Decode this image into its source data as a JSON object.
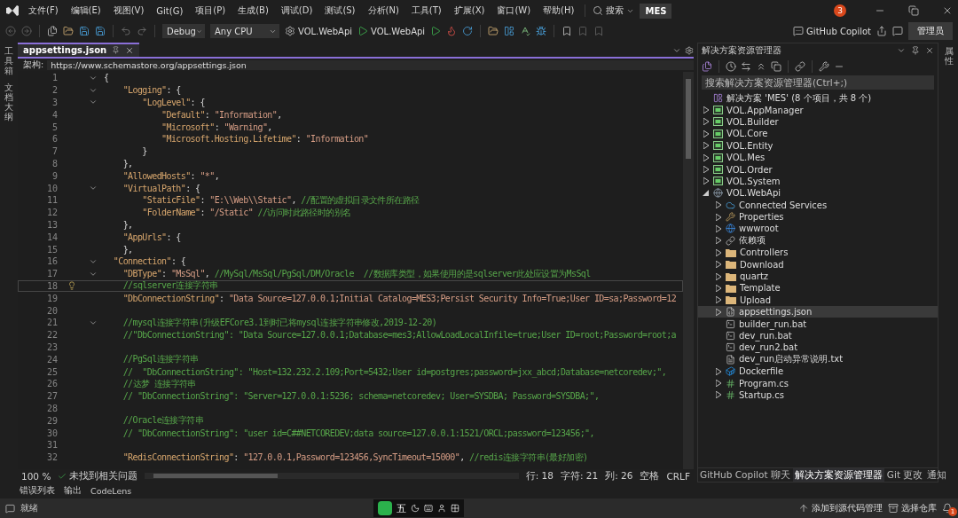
{
  "menu": {
    "items": [
      "文件(F)",
      "编辑(E)",
      "视图(V)",
      "Git(G)",
      "项目(P)",
      "生成(B)",
      "调试(D)",
      "测试(S)",
      "分析(N)",
      "工具(T)",
      "扩展(X)",
      "窗口(W)",
      "帮助(H)"
    ],
    "search": "搜索",
    "solution_badge": "MES",
    "notification_count": "3"
  },
  "toolbar": {
    "configuration": "Debug",
    "platform": "Any CPU",
    "startup_project": "VOL.WebApi",
    "run_target": "VOL.WebApi",
    "copilot": "GitHub Copilot",
    "account": "管理员"
  },
  "left_strip": [
    "工具箱",
    "文档大纲"
  ],
  "editor": {
    "tabs": [
      {
        "label": "appsettings.json",
        "selected": true
      }
    ],
    "schema_label": "架构:",
    "schema_url": "https://www.schemastore.org/appsettings.json",
    "lines": [
      {
        "number": "1",
        "fold": true,
        "current": false,
        "parts": [
          {
            "kind": "punct",
            "text": "{"
          }
        ]
      },
      {
        "number": "2",
        "fold": true,
        "current": false,
        "parts": [
          {
            "kind": "key",
            "text": "    \"Logging\""
          },
          {
            "kind": "punct",
            "text": ": {"
          }
        ]
      },
      {
        "number": "3",
        "fold": true,
        "current": false,
        "parts": [
          {
            "kind": "key",
            "text": "        \"LogLevel\""
          },
          {
            "kind": "punct",
            "text": ": {"
          }
        ]
      },
      {
        "number": "4",
        "fold": false,
        "current": false,
        "parts": [
          {
            "kind": "key",
            "text": "            \"Default\""
          },
          {
            "kind": "punct",
            "text": ": "
          },
          {
            "kind": "string",
            "text": "\"Information\""
          },
          {
            "kind": "punct",
            "text": ","
          }
        ]
      },
      {
        "number": "5",
        "fold": false,
        "current": false,
        "parts": [
          {
            "kind": "key",
            "text": "            \"Microsoft\""
          },
          {
            "kind": "punct",
            "text": ": "
          },
          {
            "kind": "string",
            "text": "\"Warning\""
          },
          {
            "kind": "punct",
            "text": ","
          }
        ]
      },
      {
        "number": "6",
        "fold": false,
        "current": false,
        "parts": [
          {
            "kind": "key",
            "text": "            \"Microsoft.Hosting.Lifetime\""
          },
          {
            "kind": "punct",
            "text": ": "
          },
          {
            "kind": "string",
            "text": "\"Information\""
          }
        ]
      },
      {
        "number": "7",
        "fold": false,
        "current": false,
        "parts": [
          {
            "kind": "punct",
            "text": "        }"
          }
        ]
      },
      {
        "number": "8",
        "fold": false,
        "current": false,
        "parts": [
          {
            "kind": "punct",
            "text": "    },"
          }
        ]
      },
      {
        "number": "9",
        "fold": false,
        "current": false,
        "parts": [
          {
            "kind": "key",
            "text": "    \"AllowedHosts\""
          },
          {
            "kind": "punct",
            "text": ": "
          },
          {
            "kind": "string",
            "text": "\"*\""
          },
          {
            "kind": "punct",
            "text": ","
          }
        ]
      },
      {
        "number": "10",
        "fold": true,
        "current": false,
        "parts": [
          {
            "kind": "key",
            "text": "    \"VirtualPath\""
          },
          {
            "kind": "punct",
            "text": ": {"
          }
        ]
      },
      {
        "number": "11",
        "fold": false,
        "current": false,
        "parts": [
          {
            "kind": "key",
            "text": "        \"StaticFile\""
          },
          {
            "kind": "punct",
            "text": ": "
          },
          {
            "kind": "string",
            "text": "\"E:\\\\Web\\\\Static\""
          },
          {
            "kind": "punct",
            "text": ", "
          },
          {
            "kind": "comment",
            "text": "//配置的虚拟目录文件所在路径"
          }
        ]
      },
      {
        "number": "12",
        "fold": false,
        "current": false,
        "parts": [
          {
            "kind": "key",
            "text": "        \"FolderName\""
          },
          {
            "kind": "punct",
            "text": ": "
          },
          {
            "kind": "string",
            "text": "\"/Static\""
          },
          {
            "kind": "comment",
            "text": " //访问时此路径时的别名"
          }
        ]
      },
      {
        "number": "13",
        "fold": false,
        "current": false,
        "parts": [
          {
            "kind": "punct",
            "text": "    },"
          }
        ]
      },
      {
        "number": "14",
        "fold": false,
        "current": false,
        "parts": [
          {
            "kind": "key",
            "text": "    \"AppUrls\""
          },
          {
            "kind": "punct",
            "text": ": {"
          }
        ]
      },
      {
        "number": "15",
        "fold": false,
        "current": false,
        "parts": [
          {
            "kind": "punct",
            "text": "    },"
          }
        ]
      },
      {
        "number": "16",
        "fold": true,
        "current": false,
        "parts": [
          {
            "kind": "key",
            "text": "  \"Connection\""
          },
          {
            "kind": "punct",
            "text": ": {"
          }
        ]
      },
      {
        "number": "17",
        "fold": true,
        "current": false,
        "parts": [
          {
            "kind": "key",
            "text": "    \"DBType\""
          },
          {
            "kind": "punct",
            "text": ": "
          },
          {
            "kind": "string",
            "text": "\"MsSql\""
          },
          {
            "kind": "punct",
            "text": ", "
          },
          {
            "kind": "comment",
            "text": "//MySql/MsSql/PgSql/DM/Oracle  //数据库类型，如果使用的是sqlserver此处应设置为MsSql"
          }
        ]
      },
      {
        "number": "18",
        "fold": false,
        "current": true,
        "parts": [
          {
            "kind": "comment",
            "text": "    //sqlserver连接字符串"
          }
        ]
      },
      {
        "number": "19",
        "fold": false,
        "current": false,
        "parts": [
          {
            "kind": "key",
            "text": "    \"DbConnectionString\""
          },
          {
            "kind": "punct",
            "text": ": "
          },
          {
            "kind": "string",
            "text": "\"Data Source=127.0.0.1;Initial Catalog=MES3;Persist Security Info=True;User ID=sa;Password=12"
          }
        ]
      },
      {
        "number": "20",
        "fold": false,
        "current": false
      },
      {
        "number": "21",
        "fold": true,
        "current": false,
        "parts": [
          {
            "kind": "comment",
            "text": "    //mysql连接字符串(升级EFCore3.1到时已将mysql连接字符串修改,2019-12-20)"
          }
        ]
      },
      {
        "number": "22",
        "fold": false,
        "current": false,
        "parts": [
          {
            "kind": "comment",
            "text": "    //\"DbConnectionString\": \"Data Source=127.0.0.1;Database=mes3;AllowLoadLocalInfile=true;User ID=root;Password=root;a"
          }
        ]
      },
      {
        "number": "23",
        "fold": false,
        "current": false
      },
      {
        "number": "24",
        "fold": false,
        "current": false,
        "parts": [
          {
            "kind": "comment",
            "text": "    //PgSql连接字符串"
          }
        ]
      },
      {
        "number": "25",
        "fold": false,
        "current": false,
        "parts": [
          {
            "kind": "comment",
            "text": "    //  \"DbConnectionString\": \"Host=132.232.2.109;Port=5432;User id=postgres;password=jxx_abcd;Database=netcoredev;\","
          }
        ]
      },
      {
        "number": "26",
        "fold": false,
        "current": false,
        "parts": [
          {
            "kind": "comment",
            "text": "    //达梦 连接字符串"
          }
        ]
      },
      {
        "number": "27",
        "fold": false,
        "current": false,
        "parts": [
          {
            "kind": "comment",
            "text": "    // \"DbConnectionString\": \"Server=127.0.0.1:5236; schema=netcoredev; User=SYSDBA; Password=SYSDBA;\","
          }
        ]
      },
      {
        "number": "28",
        "fold": false,
        "current": false
      },
      {
        "number": "29",
        "fold": false,
        "current": false,
        "parts": [
          {
            "kind": "comment",
            "text": "    //Oracle连接字符串"
          }
        ]
      },
      {
        "number": "30",
        "fold": false,
        "current": false,
        "parts": [
          {
            "kind": "comment",
            "text": "    // \"DbConnectionString\": \"user id=C##NETCOREDEV;data source=127.0.0.1:1521/ORCL;password=123456;\","
          }
        ]
      },
      {
        "number": "31",
        "fold": false,
        "current": false
      },
      {
        "number": "32",
        "fold": false,
        "current": false,
        "parts": [
          {
            "kind": "key",
            "text": "    \"RedisConnectionString\""
          },
          {
            "kind": "punct",
            "text": ": "
          },
          {
            "kind": "string",
            "text": "\"127.0.0.1,Password=123456,SyncTimeout=15000\""
          },
          {
            "kind": "punct",
            "text": ", "
          },
          {
            "kind": "comment",
            "text": "//redis连接字符串(最好加密)"
          }
        ]
      }
    ],
    "status": {
      "zoom": "100 %",
      "issues": "未找到相关问题",
      "line": "行: 18",
      "char": "字符: 21",
      "col": "列: 26",
      "spaces": "空格",
      "eol": "CRLF"
    }
  },
  "solution_explorer": {
    "title": "解决方案资源管理器",
    "search_placeholder": "搜索解决方案资源管理器(Ctrl+;)",
    "tree": [
      {
        "label": "解决方案 'MES' (8 个项目，共 8 个)",
        "kind": "solution",
        "selected": false,
        "children": [
          {
            "label": "VOL.AppManager",
            "kind": "project",
            "expandable": true,
            "expanded": false,
            "selected": false
          },
          {
            "label": "VOL.Builder",
            "kind": "project",
            "expandable": true,
            "expanded": false,
            "selected": false
          },
          {
            "label": "VOL.Core",
            "kind": "project",
            "expandable": true,
            "expanded": false,
            "selected": false
          },
          {
            "label": "VOL.Entity",
            "kind": "project",
            "expandable": true,
            "expanded": false,
            "selected": false
          },
          {
            "label": "VOL.Mes",
            "kind": "project",
            "expandable": true,
            "expanded": false,
            "selected": false
          },
          {
            "label": "VOL.Order",
            "kind": "project",
            "expandable": true,
            "expanded": false,
            "selected": false
          },
          {
            "label": "VOL.System",
            "kind": "project",
            "expandable": true,
            "expanded": false,
            "selected": false
          },
          {
            "label": "VOL.WebApi",
            "kind": "webproject",
            "expandable": true,
            "expanded": true,
            "selected": false,
            "children": [
              {
                "label": "Connected Services",
                "kind": "cloud",
                "expandable": true,
                "expanded": false,
                "selected": false
              },
              {
                "label": "Properties",
                "kind": "properties",
                "expandable": true,
                "expanded": false,
                "selected": false
              },
              {
                "label": "wwwroot",
                "kind": "globe",
                "expandable": true,
                "expanded": false,
                "selected": false
              },
              {
                "label": "依赖项",
                "kind": "dependencies",
                "expandable": true,
                "expanded": false,
                "selected": false
              },
              {
                "label": "Controllers",
                "kind": "folder",
                "expandable": true,
                "expanded": false,
                "selected": false
              },
              {
                "label": "Download",
                "kind": "folder",
                "expandable": true,
                "expanded": false,
                "selected": false
              },
              {
                "label": "quartz",
                "kind": "folder",
                "expandable": true,
                "expanded": false,
                "selected": false
              },
              {
                "label": "Template",
                "kind": "folder",
                "expandable": true,
                "expanded": false,
                "selected": false
              },
              {
                "label": "Upload",
                "kind": "folder",
                "expandable": true,
                "expanded": false,
                "selected": false
              },
              {
                "label": "appsettings.json",
                "kind": "json",
                "expandable": true,
                "expanded": false,
                "selected": true
              },
              {
                "label": "builder_run.bat",
                "kind": "bat",
                "expandable": false,
                "expanded": false,
                "selected": false
              },
              {
                "label": "dev_run.bat",
                "kind": "bat",
                "expandable": false,
                "expanded": false,
                "selected": false
              },
              {
                "label": "dev_run2.bat",
                "kind": "bat",
                "expandable": false,
                "expanded": false,
                "selected": false
              },
              {
                "label": "dev_run启动异常说明.txt",
                "kind": "text",
                "expandable": false,
                "expanded": false,
                "selected": false
              },
              {
                "label": "Dockerfile",
                "kind": "docker",
                "expandable": true,
                "expanded": false,
                "selected": false
              },
              {
                "label": "Program.cs",
                "kind": "csharp",
                "expandable": true,
                "expanded": false,
                "selected": false
              },
              {
                "label": "Startup.cs",
                "kind": "csharp",
                "expandable": true,
                "expanded": false,
                "selected": false
              }
            ]
          }
        ]
      }
    ],
    "tabs": [
      {
        "label": "GitHub Copilot 聊天",
        "selected": false
      },
      {
        "label": "解决方案资源管理器",
        "selected": true
      },
      {
        "label": "Git 更改",
        "selected": false
      },
      {
        "label": "通知",
        "selected": false
      }
    ]
  },
  "right_strip": [
    "属性"
  ],
  "bottom_tabs": [
    "错误列表",
    "输出",
    "CodeLens"
  ],
  "status_bar": {
    "message": "就绪",
    "ime": "五",
    "source_control": "添加到源代码管理",
    "repository": "选择仓库",
    "notifications": "1"
  }
}
